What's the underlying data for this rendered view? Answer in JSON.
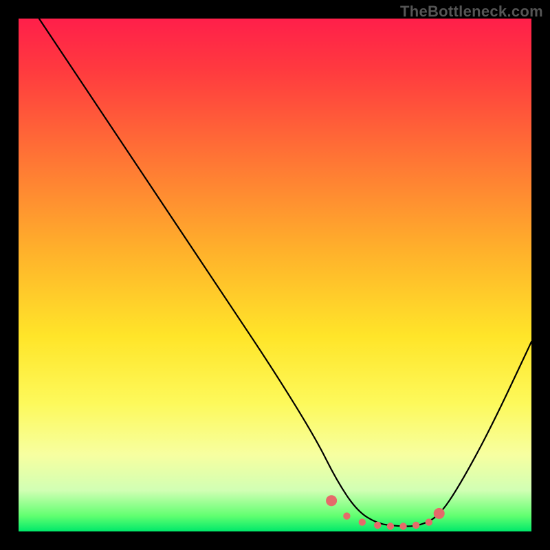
{
  "watermark": "TheBottleneck.com",
  "colors": {
    "frame_bg": "#000000",
    "marker": "#e56a6a",
    "curve": "#000000",
    "gradient_top": "#ff1f4a",
    "gradient_bottom": "#00e86a"
  },
  "chart_data": {
    "type": "line",
    "title": "",
    "xlabel": "",
    "ylabel": "",
    "xlim": [
      0,
      100
    ],
    "ylim": [
      0,
      100
    ],
    "note": "Approximate values read from un-labeled axes; y≈0 at bottom, y≈100 at top; curve traces bottleneck percentage vs. component index.",
    "series": [
      {
        "name": "bottleneck-curve",
        "x": [
          4,
          10,
          20,
          30,
          40,
          50,
          58,
          62,
          66,
          70,
          74,
          78,
          82,
          86,
          92,
          100
        ],
        "y": [
          100,
          91,
          76,
          61,
          46,
          31,
          18,
          10,
          4,
          1.5,
          1,
          1,
          3,
          9,
          20,
          37
        ]
      }
    ],
    "markers": {
      "name": "highlight-dots",
      "x": [
        61,
        64,
        67,
        70,
        72.5,
        75,
        77.5,
        80,
        82
      ],
      "y": [
        6,
        3,
        1.8,
        1.2,
        1,
        1,
        1.2,
        1.8,
        3.5
      ]
    }
  }
}
